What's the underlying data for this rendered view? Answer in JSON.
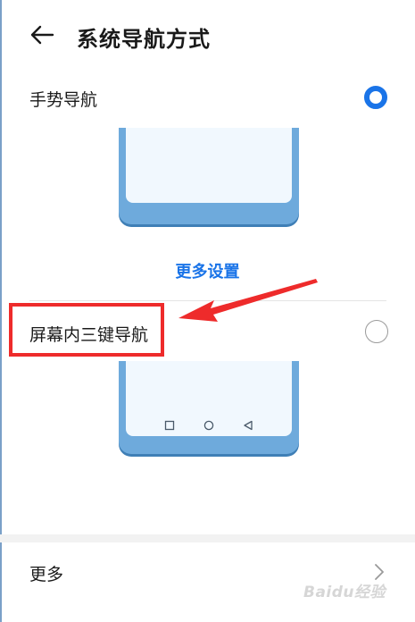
{
  "header": {
    "title": "系统导航方式"
  },
  "options": {
    "gesture": {
      "label": "手势导航",
      "selected": true
    },
    "three_key": {
      "label": "屏幕内三键导航",
      "selected": false
    }
  },
  "more_settings_link": "更多设置",
  "more": {
    "label": "更多"
  },
  "watermark": "Baidu经验",
  "colors": {
    "accent": "#1a74e8",
    "highlight": "#ee2b2b",
    "phone_frame": "#6eaadc"
  },
  "icons": {
    "back": "arrow-left",
    "chevron": "chevron-right",
    "nav_keys": [
      "square",
      "circle",
      "triangle-back"
    ]
  }
}
